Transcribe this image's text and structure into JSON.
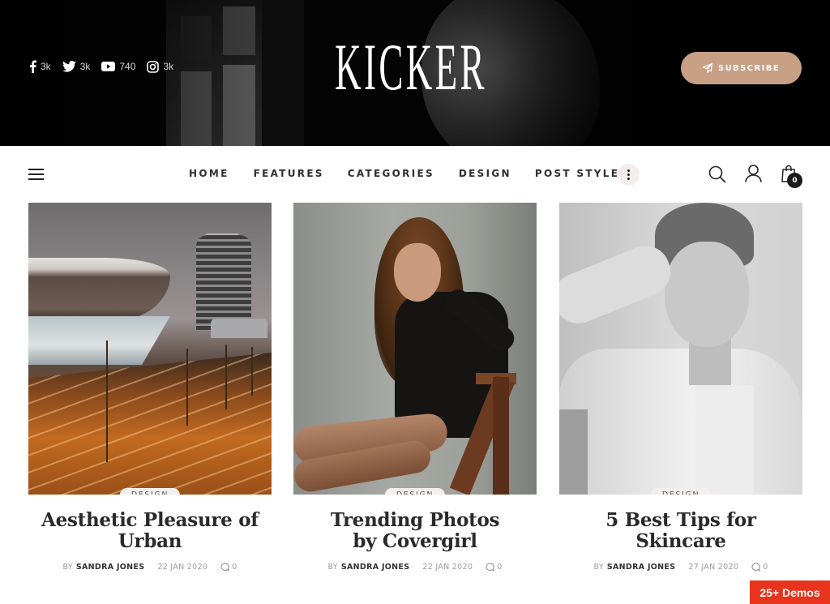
{
  "header": {
    "logo": "KICKER",
    "social": [
      {
        "icon": "facebook-icon",
        "count": "3k"
      },
      {
        "icon": "twitter-icon",
        "count": "3k"
      },
      {
        "icon": "youtube-icon",
        "count": "740"
      },
      {
        "icon": "instagram-icon",
        "count": "3k"
      }
    ],
    "subscribe_label": "SUBSCRIBE",
    "subscribe_icon": "paper-plane-icon"
  },
  "nav": {
    "items": [
      "HOME",
      "FEATURES",
      "CATEGORIES",
      "DESIGN",
      "POST STYLES"
    ],
    "more_icon": "vertical-dots-icon",
    "cart_count": "0"
  },
  "posts": [
    {
      "category": "DESIGN",
      "title": "Aesthetic Pleasure of Urban",
      "by": "BY",
      "author": "SANDRA JONES",
      "date": "22 JAN 2020",
      "comments": "0"
    },
    {
      "category": "DESIGN",
      "title": "Trending Photos by Covergirl",
      "by": "BY",
      "author": "SANDRA JONES",
      "date": "22 JAN 2020",
      "comments": "0"
    },
    {
      "category": "DESIGN",
      "title": "5 Best Tips for Skincare",
      "by": "BY",
      "author": "SANDRA JONES",
      "date": "27 JAN 2020",
      "comments": "0"
    }
  ],
  "demos_label": "25+ Demos",
  "colors": {
    "accent": "#c7a086",
    "demos": "#e8341c",
    "badge_bg": "#f4efed",
    "hero_bg": "#050505"
  }
}
